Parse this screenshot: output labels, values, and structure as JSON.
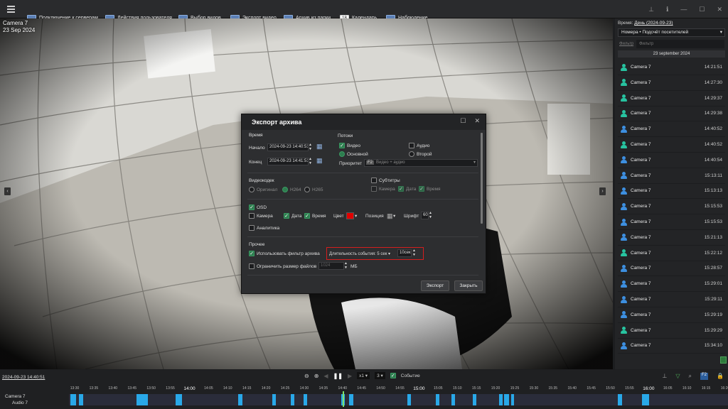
{
  "toolbar": {
    "items": [
      {
        "label": "Подключение к серверам",
        "icon": "server-connect-icon"
      },
      {
        "label": "Действия пользователя",
        "icon": "user-actions-icon"
      },
      {
        "label": "Выбор видов",
        "icon": "views-icon"
      },
      {
        "label": "Экспорт видео",
        "icon": "video-export-icon"
      },
      {
        "label": "Архив из папки",
        "icon": "archive-folder-icon"
      },
      {
        "label": "Календарь",
        "icon": "calendar-icon",
        "badge": "18"
      },
      {
        "label": "Наблюдение",
        "icon": "monitor-icon"
      }
    ]
  },
  "video": {
    "camera": "Camera 7",
    "date": "23 Sep 2024"
  },
  "dialog": {
    "title": "Экспорт архива",
    "time": {
      "section": "Время",
      "start_label": "Начало",
      "start_value": "2024-09-23 14:40:51",
      "end_label": "Конец",
      "end_value": "2024-09-23 14:41:51"
    },
    "streams": {
      "section": "Потоки",
      "video": "Видео",
      "audio": "Аудио",
      "main": "Основной",
      "second": "Второй",
      "priority_label": "Приоритет",
      "priority_value": "Видео + аудио",
      "priority_badge": "F2"
    },
    "codec": {
      "section": "Видеокодек",
      "original": "Оригинал",
      "h264": "H264",
      "h265": "H265"
    },
    "subtitles": {
      "label": "Субтитры",
      "camera": "Камера",
      "date": "Дата",
      "time": "Время"
    },
    "osd": {
      "label": "OSD",
      "camera": "Камера",
      "date": "Дата",
      "time": "Время",
      "color_label": "Цвет",
      "color": "#e00000",
      "position_label": "Позиция",
      "font_label": "Шрифт",
      "font_value": "60",
      "analytics": "Аналитика"
    },
    "other": {
      "section": "Прочее",
      "use_filter": "Использовать фильтр архива",
      "event_duration": "Длительность события: 5 сек",
      "event_value": "10сек",
      "limit_size": "Ограничить размер файлов",
      "limit_value": "1024",
      "limit_unit": "МБ"
    },
    "export_btn": "Экспорт",
    "close_btn": "Закрыть"
  },
  "sidebar": {
    "time_label": "Время:",
    "time_value": "День (2024-09-23)",
    "dropdown": "Номера • Подсчёт посетителей",
    "filter_label": "Фильтр",
    "filter_placeholder": "Фильтр",
    "date_header": "23 september 2024",
    "events": [
      {
        "camera": "Camera 7",
        "time": "14:21:51",
        "type": "teal"
      },
      {
        "camera": "Camera 7",
        "time": "14:27:30",
        "type": "teal"
      },
      {
        "camera": "Camera 7",
        "time": "14:29:37",
        "type": "teal"
      },
      {
        "camera": "Camera 7",
        "time": "14:29:38",
        "type": "teal"
      },
      {
        "camera": "Camera 7",
        "time": "14:40:52",
        "type": "blue"
      },
      {
        "camera": "Camera 7",
        "time": "14:40:52",
        "type": "teal"
      },
      {
        "camera": "Camera 7",
        "time": "14:40:54",
        "type": "blue"
      },
      {
        "camera": "Camera 7",
        "time": "15:13:11",
        "type": "blue"
      },
      {
        "camera": "Camera 7",
        "time": "15:13:13",
        "type": "blue"
      },
      {
        "camera": "Camera 7",
        "time": "15:15:53",
        "type": "blue"
      },
      {
        "camera": "Camera 7",
        "time": "15:15:53",
        "type": "blue"
      },
      {
        "camera": "Camera 7",
        "time": "15:21:13",
        "type": "blue"
      },
      {
        "camera": "Camera 7",
        "time": "15:22:12",
        "type": "teal"
      },
      {
        "camera": "Camera 7",
        "time": "15:28:57",
        "type": "blue"
      },
      {
        "camera": "Camera 7",
        "time": "15:29:01",
        "type": "blue"
      },
      {
        "camera": "Camera 7",
        "time": "15:29:11",
        "type": "blue"
      },
      {
        "camera": "Camera 7",
        "time": "15:29:19",
        "type": "blue"
      },
      {
        "camera": "Camera 7",
        "time": "15:29:29",
        "type": "teal"
      },
      {
        "camera": "Camera 7",
        "time": "15:34:10",
        "type": "blue"
      }
    ]
  },
  "timeline": {
    "current": "2024-09-23 14:40:51",
    "speed": "x1",
    "step": "3",
    "event_label": "Событие",
    "camera": "Camera 7",
    "audio": "Audio 7",
    "ticks": [
      "13:30",
      "13:35",
      "13:40",
      "13:45",
      "13:50",
      "13:55",
      "14:00",
      "14:05",
      "14:10",
      "14:15",
      "14:20",
      "14:25",
      "14:30",
      "14:35",
      "14:40",
      "14:45",
      "14:50",
      "14:55",
      "15:00",
      "15:05",
      "15:10",
      "15:15",
      "15:20",
      "15:25",
      "15:30",
      "15:35",
      "15:40",
      "15:45",
      "15:50",
      "15:55",
      "16:00",
      "16:05",
      "16:10",
      "16:15",
      "16:20"
    ]
  }
}
